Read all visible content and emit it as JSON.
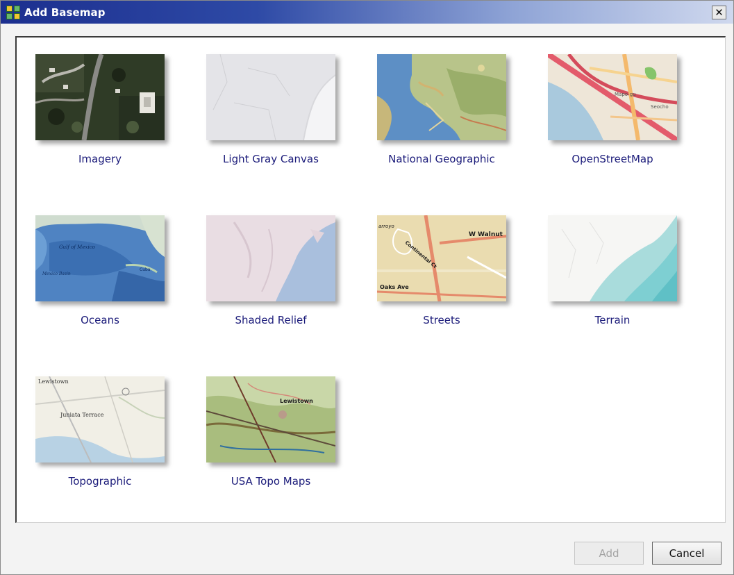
{
  "window": {
    "title": "Add Basemap",
    "close_glyph": "✕"
  },
  "basemaps": [
    {
      "label": "Imagery"
    },
    {
      "label": "Light Gray Canvas"
    },
    {
      "label": "National Geographic"
    },
    {
      "label": "OpenStreetMap"
    },
    {
      "label": "Oceans"
    },
    {
      "label": "Shaded Relief"
    },
    {
      "label": "Streets"
    },
    {
      "label": "Terrain"
    },
    {
      "label": "Topographic"
    },
    {
      "label": "USA Topo Maps"
    }
  ],
  "thumbnail_text": {
    "opm_a": "Mapo-gu",
    "opm_b": "Seocho",
    "oceans_a": "Gulf of Mexico",
    "oceans_b": "Mexico Basin",
    "oceans_c": "Cuba",
    "streets_a": "W Walnut",
    "streets_b": "Oaks Ave",
    "streets_c": "Continental Ct",
    "streets_d": "arroyo",
    "topo_a": "Lewistown",
    "topo_b": "Juniata Terrace",
    "usatopo_a": "Lewistown"
  },
  "buttons": {
    "add": "Add",
    "cancel": "Cancel"
  },
  "colors": {
    "label_text": "#1b1b7a",
    "title_bar_start": "#1c2f8f"
  }
}
